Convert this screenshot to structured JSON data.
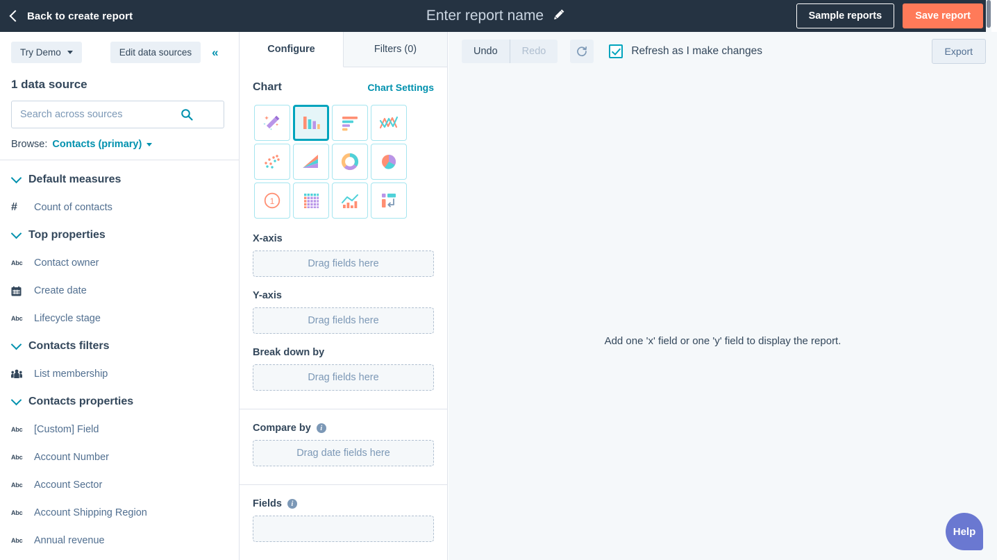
{
  "topbar": {
    "back_label": "Back to create report",
    "back_icon": "chevron-left-icon",
    "report_name": "Enter report name",
    "edit_icon": "pencil-icon",
    "sample_reports_label": "Sample reports",
    "save_report_label": "Save report",
    "bg_color": "#253342",
    "primary_color": "#ff7a59"
  },
  "sidebar": {
    "try_demo_label": "Try Demo",
    "edit_sources_label": "Edit data sources",
    "collapse_icon": "double-chevron-left-icon",
    "data_source_count": "1 data source",
    "search_placeholder": "Search across sources",
    "search_value": "",
    "search_icon": "search-icon",
    "browse_label": "Browse:",
    "browse_value": "Contacts (primary)",
    "groups": [
      {
        "label": "Default measures",
        "items": [
          {
            "label": "Count of contacts",
            "icon": "hash-icon"
          }
        ]
      },
      {
        "label": "Top properties",
        "items": [
          {
            "label": "Contact owner",
            "icon": "abc-icon"
          },
          {
            "label": "Create date",
            "icon": "calendar-icon"
          },
          {
            "label": "Lifecycle stage",
            "icon": "abc-icon"
          }
        ]
      },
      {
        "label": "Contacts filters",
        "items": [
          {
            "label": "List membership",
            "icon": "list-membership-icon"
          }
        ]
      },
      {
        "label": "Contacts properties",
        "items": [
          {
            "label": "[Custom] Field",
            "icon": "abc-icon"
          },
          {
            "label": "Account Number",
            "icon": "abc-icon"
          },
          {
            "label": "Account Sector",
            "icon": "abc-icon"
          },
          {
            "label": "Account Shipping Region",
            "icon": "abc-icon"
          },
          {
            "label": "Annual revenue",
            "icon": "abc-icon"
          }
        ]
      }
    ]
  },
  "config": {
    "tabs": [
      {
        "label": "Configure",
        "active": true
      },
      {
        "label": "Filters (0)",
        "active": false
      }
    ],
    "chart_title": "Chart",
    "chart_settings_label": "Chart Settings",
    "chart_types": [
      {
        "name": "magic-wand-icon",
        "selected": false
      },
      {
        "name": "vertical-bar-chart-icon",
        "selected": true
      },
      {
        "name": "horizontal-bar-chart-icon",
        "selected": false
      },
      {
        "name": "line-chart-icon",
        "selected": false
      },
      {
        "name": "scatter-chart-icon",
        "selected": false
      },
      {
        "name": "area-chart-icon",
        "selected": false
      },
      {
        "name": "donut-chart-icon",
        "selected": false
      },
      {
        "name": "pie-chart-icon",
        "selected": false
      },
      {
        "name": "single-value-icon",
        "selected": false
      },
      {
        "name": "table-chart-icon",
        "selected": false
      },
      {
        "name": "combo-chart-icon",
        "selected": false
      },
      {
        "name": "pivot-table-icon",
        "selected": false
      }
    ],
    "selected_border_color": "#00a4bd",
    "selected_bg_color": "#e5f5f8",
    "x_axis_label": "X-axis",
    "x_axis_placeholder": "Drag fields here",
    "y_axis_label": "Y-axis",
    "y_axis_placeholder": "Drag fields here",
    "breakdown_label": "Break down by",
    "breakdown_placeholder": "Drag fields here",
    "compare_label": "Compare by",
    "compare_placeholder": "Drag date fields here",
    "fields_label": "Fields",
    "info_icon": "info-icon"
  },
  "main": {
    "undo_label": "Undo",
    "redo_label": "Redo",
    "refresh_icon": "refresh-icon",
    "refresh_checkbox_label": "Refresh as I make changes",
    "refresh_checkbox_checked": true,
    "export_label": "Export",
    "empty_message": "Add one 'x' field or one 'y' field to display the report.",
    "help_label": "Help",
    "help_color": "#6a78d1"
  }
}
